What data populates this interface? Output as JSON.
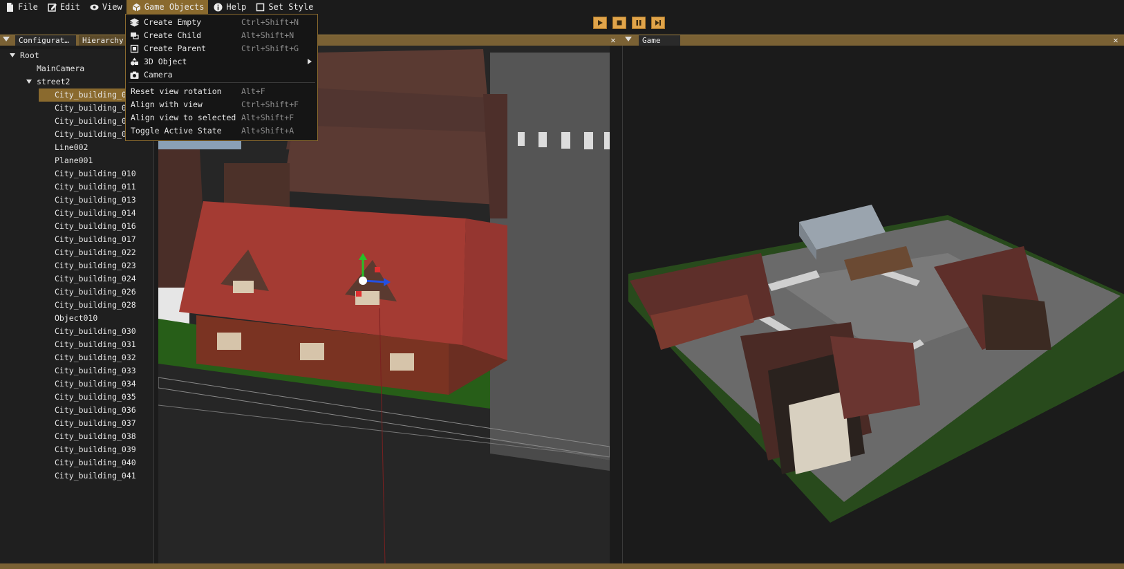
{
  "menubar": {
    "items": [
      {
        "label": "File",
        "icon": "file-icon"
      },
      {
        "label": "Edit",
        "icon": "edit-icon"
      },
      {
        "label": "View",
        "icon": "eye-icon"
      },
      {
        "label": "Game Objects",
        "icon": "cube-icon"
      },
      {
        "label": "Help",
        "icon": "info-icon"
      },
      {
        "label": "Set Style",
        "icon": "square-icon"
      }
    ]
  },
  "dropdown": {
    "items": [
      {
        "label": "Create Empty",
        "shortcut": "Ctrl+Shift+N",
        "icon": "layers-icon"
      },
      {
        "label": "Create Child",
        "shortcut": "Alt+Shift+N",
        "icon": "create-child-icon"
      },
      {
        "label": "Create Parent",
        "shortcut": "Ctrl+Shift+G",
        "icon": "create-parent-icon"
      },
      {
        "label": "3D Object",
        "shortcut": "",
        "icon": "shapes-icon"
      },
      {
        "label": "Camera",
        "shortcut": "",
        "icon": "camera-icon"
      },
      {
        "label": "Reset view rotation",
        "shortcut": "Alt+F"
      },
      {
        "label": "Align with view",
        "shortcut": "Ctrl+Shift+F"
      },
      {
        "label": "Align view to selected",
        "shortcut": "Alt+Shift+F"
      },
      {
        "label": "Toggle Active State",
        "shortcut": "Alt+Shift+A"
      }
    ]
  },
  "left_panel": {
    "tabs": [
      "Configurat…",
      "Hierarchy"
    ]
  },
  "game_panel": {
    "tab": "Game"
  },
  "close_label": "✕",
  "hierarchy": {
    "root": "Root",
    "camera": "MainCamera",
    "group": "street2",
    "children": [
      "City_building_0",
      "City_building_0",
      "City_building_0",
      "City_building_0",
      "Line002",
      "Plane001",
      "City_building_010",
      "City_building_011",
      "City_building_013",
      "City_building_014",
      "City_building_016",
      "City_building_017",
      "City_building_022",
      "City_building_023",
      "City_building_024",
      "City_building_026",
      "City_building_028",
      "Object010",
      "City_building_030",
      "City_building_031",
      "City_building_032",
      "City_building_033",
      "City_building_034",
      "City_building_035",
      "City_building_036",
      "City_building_037",
      "City_building_038",
      "City_building_039",
      "City_building_040",
      "City_building_041"
    ]
  },
  "colors": {
    "accent": "#8a6a2e",
    "titlebar": "#7a6134",
    "play_button": "#e0a44a"
  }
}
